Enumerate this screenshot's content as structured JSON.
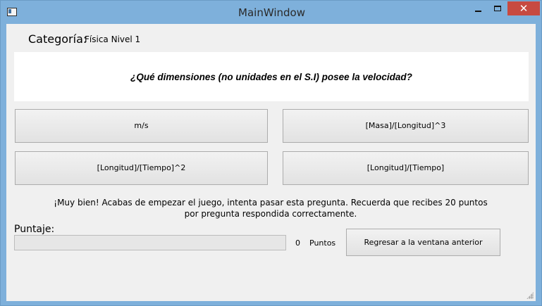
{
  "window": {
    "title": "MainWindow",
    "close_glyph": "✕",
    "icons": [
      "app-icon",
      "minimize-icon",
      "maximize-icon",
      "close-icon"
    ]
  },
  "category": {
    "label": "Categoría:",
    "value": "Física Nivel 1"
  },
  "question": {
    "text": "¿Qué dimensiones (no unidades en el S.I) posee la velocidad?"
  },
  "answers": [
    {
      "label": "m/s"
    },
    {
      "label": "[Masa]/[Longitud]^3"
    },
    {
      "label": "[Longitud]/[Tiempo]^2"
    },
    {
      "label": "[Longitud]/[Tiempo]"
    }
  ],
  "message": {
    "text": "¡Muy bien! Acabas de empezar el juego, intenta pasar esta pregunta. Recuerda que recibes 20 puntos por pregunta respondida correctamente."
  },
  "score": {
    "label": "Puntaje:",
    "value": "0",
    "unit": "Puntos",
    "progress_fraction": 0
  },
  "back_button": {
    "label": "Regresar a la ventana anterior"
  },
  "colors": {
    "titlebar": "#7eb0db",
    "close_button": "#c74a41",
    "client_background": "#f0f0f0",
    "progress_fill": "#06b025"
  }
}
